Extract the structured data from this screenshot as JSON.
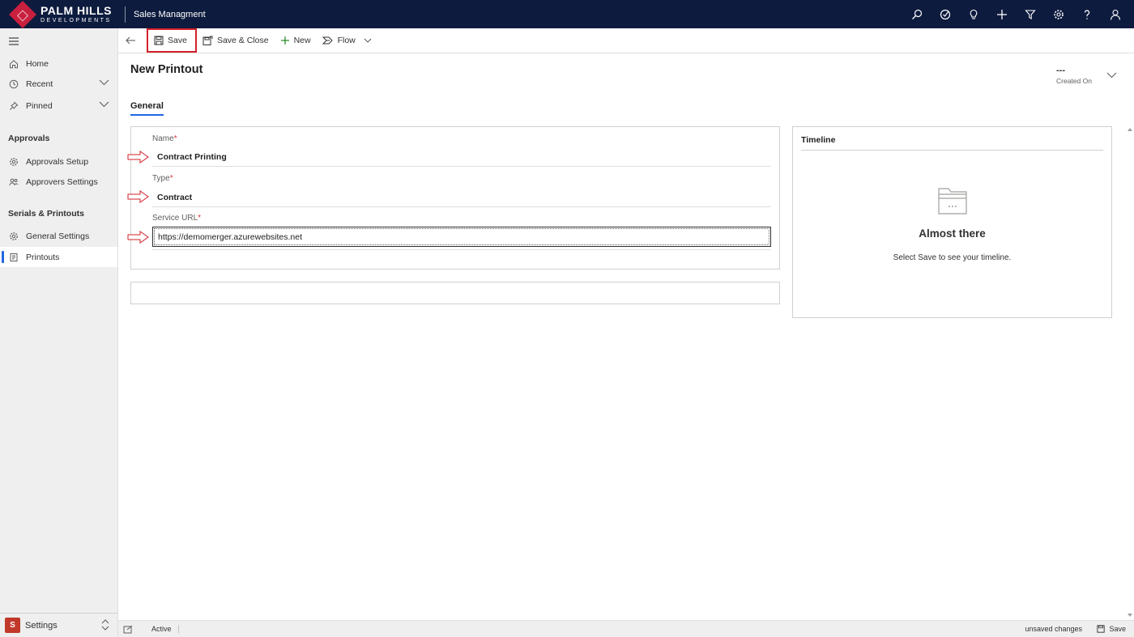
{
  "topbar": {
    "logo_main": "PALM HILLS",
    "logo_sub": "DEVELOPMENTS",
    "app_name": "Sales Managment",
    "icons": [
      "search-icon",
      "task-icon",
      "lightbulb-icon",
      "plus-icon",
      "filter-icon",
      "gear-icon",
      "help-icon",
      "user-icon"
    ]
  },
  "sidebar": {
    "items": [
      {
        "label": "Home",
        "icon": "home-icon"
      },
      {
        "label": "Recent",
        "icon": "clock-icon"
      },
      {
        "label": "Pinned",
        "icon": "pin-icon"
      }
    ],
    "sections": [
      {
        "title": "Approvals",
        "items": [
          {
            "label": "Approvals Setup",
            "icon": "gear-icon"
          },
          {
            "label": "Approvers Settings",
            "icon": "people-icon"
          }
        ]
      },
      {
        "title": "Serials & Printouts",
        "items": [
          {
            "label": "General Settings",
            "icon": "gear-icon"
          },
          {
            "label": "Printouts",
            "icon": "document-icon"
          }
        ]
      }
    ],
    "selected": "Printouts",
    "area": {
      "badge": "S",
      "label": "Settings"
    }
  },
  "commandbar": {
    "save": "Save",
    "save_close": "Save & Close",
    "new": "New",
    "flow": "Flow"
  },
  "form": {
    "title": "New Printout",
    "header_field_value": "---",
    "header_field_label": "Created On",
    "tab": "General",
    "fields": {
      "name_label": "Name",
      "name_value": "Contract Printing",
      "type_label": "Type",
      "type_value": "Contract",
      "url_label": "Service URL",
      "url_value": "https://demomerger.azurewebsites.net",
      "required_marker": "*"
    }
  },
  "timeline": {
    "title": "Timeline",
    "empty_title": "Almost there",
    "empty_hint": "Select Save to see your timeline."
  },
  "footer": {
    "status": "Active",
    "unsaved": "unsaved changes",
    "save": "Save"
  },
  "colors": {
    "topbar": "#0d1b3e",
    "accent": "#2266e3",
    "highlight": "#d3202a",
    "brand": "#c8203e"
  }
}
